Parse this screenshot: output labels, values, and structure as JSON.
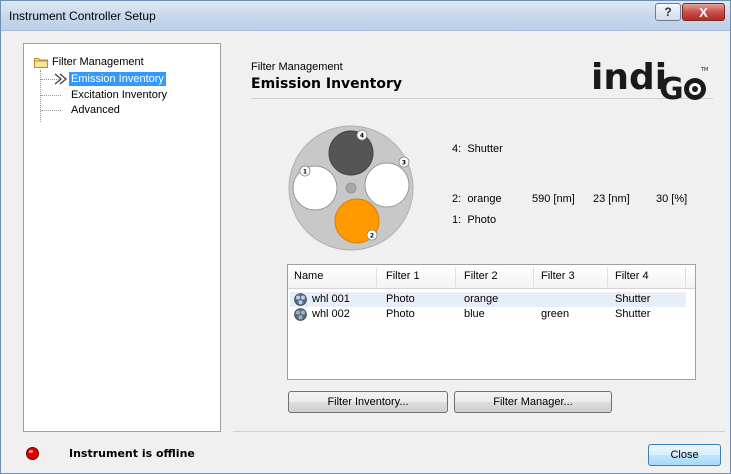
{
  "window": {
    "title": "Instrument Controller Setup",
    "help_glyph": "?",
    "close_glyph": "X"
  },
  "tree": {
    "root": "Filter Management",
    "items": [
      {
        "label": "Emission Inventory",
        "selected": true
      },
      {
        "label": "Excitation Inventory",
        "selected": false
      },
      {
        "label": "Advanced",
        "selected": false
      }
    ]
  },
  "header": {
    "section": "Filter Management",
    "title": "Emission Inventory",
    "logo_text": "indiGO",
    "logo_tm": "TM"
  },
  "wheel": {
    "slot_numbers": [
      "4",
      "3",
      "1",
      "2"
    ],
    "colors": {
      "shutter": "#555555",
      "orange": "#ff9900",
      "empty": "#ffffff",
      "plate": "#c8c8c8"
    }
  },
  "filter_info": {
    "slot4": {
      "index": "4:",
      "name": "Shutter"
    },
    "slot2": {
      "index": "2:",
      "name": "orange",
      "wavelength": "590 [nm]",
      "bandwidth": "23 [nm]",
      "transmission": "30 [%]"
    },
    "slot1": {
      "index": "1:",
      "name": "Photo"
    }
  },
  "table": {
    "columns": [
      "Name",
      "Filter 1",
      "Filter 2",
      "Filter 3",
      "Filter 4"
    ],
    "rows": [
      {
        "name": "whl 001",
        "f1": "Photo",
        "f2": "orange",
        "f3": "",
        "f4": "Shutter"
      },
      {
        "name": "whl 002",
        "f1": "Photo",
        "f2": "blue",
        "f3": "green",
        "f4": "Shutter"
      }
    ]
  },
  "buttons": {
    "filter_inventory": "Filter Inventory...",
    "filter_manager": "Filter Manager...",
    "close": "Close"
  },
  "status": {
    "text": "Instrument is offline",
    "color": "#dd0000"
  }
}
